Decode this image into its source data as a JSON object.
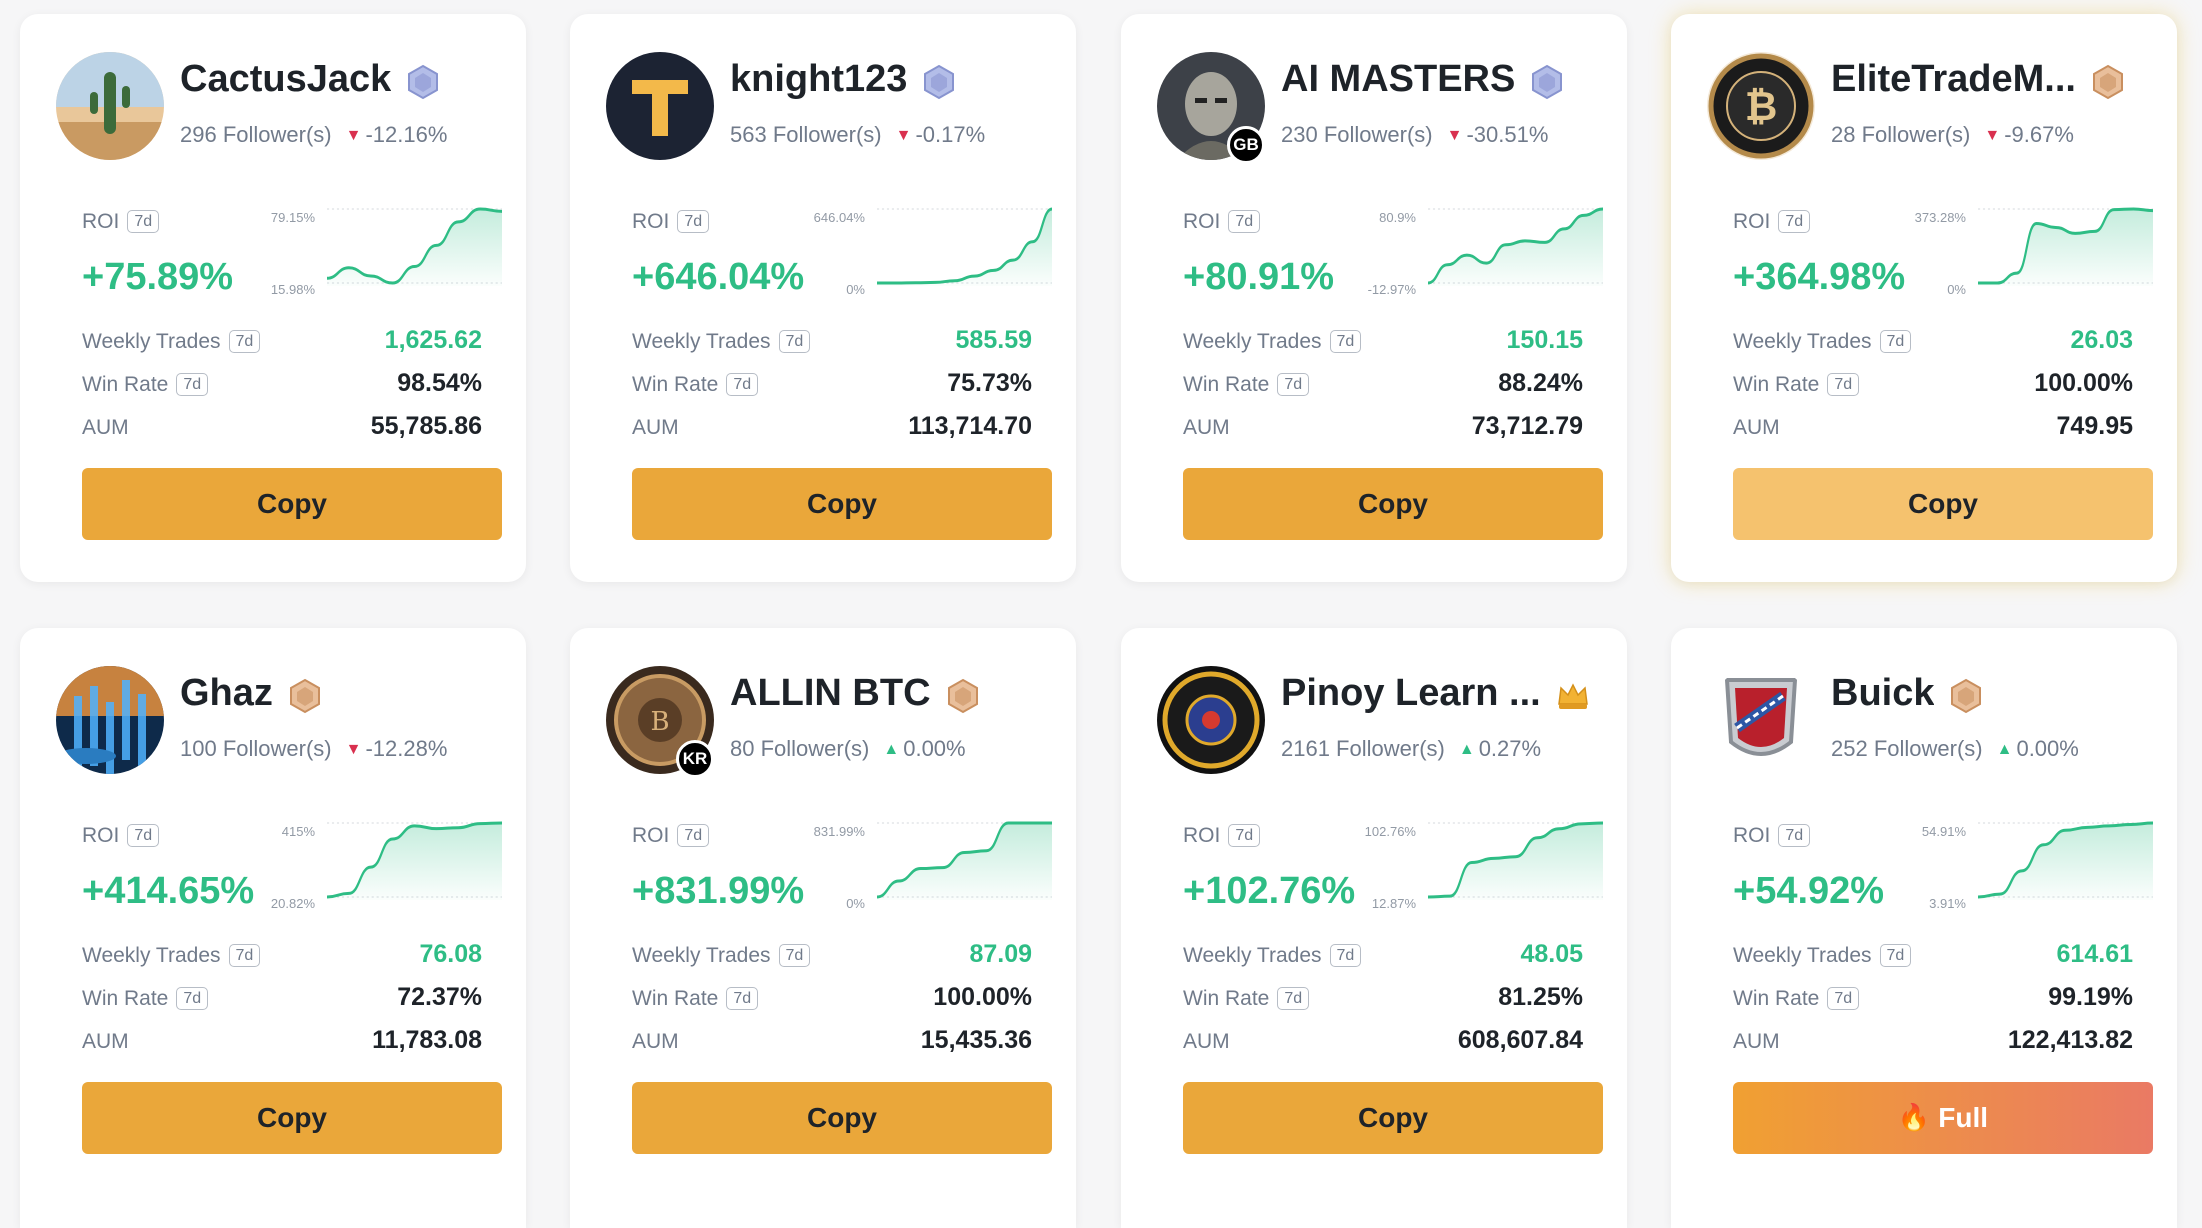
{
  "common": {
    "roi_label": "ROI",
    "weekly_trades_label": "Weekly Trades",
    "win_rate_label": "Win Rate",
    "aum_label": "AUM",
    "period_tag": "7d"
  },
  "colors": {
    "positive": "#2ebd85",
    "negative": "#d9304f",
    "copy_button": "#eaa73a",
    "copy_button_light": "#f5c26e",
    "full_button_gradient": [
      "#f0a032",
      "#ea7a64"
    ]
  },
  "traders": [
    {
      "name": "CactusJack",
      "badge": "diamond-badge-icon",
      "followers": "296 Follower(s)",
      "change": "-12.16%",
      "change_dir": "down",
      "roi": "+75.89%",
      "chart_max": "79.15%",
      "chart_min": "15.98%",
      "sparkline": [
        20,
        29,
        22,
        16,
        30,
        48,
        68,
        79,
        77
      ],
      "weekly_trades": "1,625.62",
      "win_rate": "98.54%",
      "aum": "55,785.86",
      "button": "Copy",
      "button_style": "copy",
      "avatar": "cactus-avatar",
      "country": ""
    },
    {
      "name": "knight123",
      "badge": "diamond-badge-icon",
      "followers": "563 Follower(s)",
      "change": "-0.17%",
      "change_dir": "down",
      "roi": "+646.04%",
      "chart_max": "646.04%",
      "chart_min": "0%",
      "sparkline": [
        0,
        0,
        2,
        5,
        20,
        60,
        110,
        200,
        360,
        646
      ],
      "weekly_trades": "585.59",
      "win_rate": "75.73%",
      "aum": "113,714.70",
      "button": "Copy",
      "button_style": "copy",
      "avatar": "letter-t-avatar",
      "country": ""
    },
    {
      "name": "AI MASTERS",
      "badge": "diamond-badge-icon",
      "followers": "230 Follower(s)",
      "change": "-30.51%",
      "change_dir": "down",
      "roi": "+80.91%",
      "chart_max": "80.9%",
      "chart_min": "-12.97%",
      "sparkline": [
        -13,
        10,
        22,
        12,
        35,
        40,
        38,
        55,
        72,
        80
      ],
      "weekly_trades": "150.15",
      "win_rate": "88.24%",
      "aum": "73,712.79",
      "button": "Copy",
      "button_style": "copy",
      "avatar": "robot-portrait-avatar",
      "country": "GB"
    },
    {
      "name": "EliteTradeM...",
      "badge": "bronze-badge-icon",
      "followers": "28 Follower(s)",
      "change": "-9.67%",
      "change_dir": "down",
      "roi": "+364.98%",
      "chart_max": "373.28%",
      "chart_min": "0%",
      "sparkline": [
        0,
        0,
        50,
        300,
        280,
        250,
        260,
        370,
        373,
        365
      ],
      "weekly_trades": "26.03",
      "win_rate": "100.00%",
      "aum": "749.95",
      "button": "Copy",
      "button_style": "light",
      "avatar": "bitcoin-coin-avatar",
      "country": ""
    },
    {
      "name": "Ghaz",
      "badge": "bronze-badge-icon",
      "followers": "100 Follower(s)",
      "change": "-12.28%",
      "change_dir": "down",
      "roi": "+414.65%",
      "chart_max": "415%",
      "chart_min": "20.82%",
      "sparkline": [
        21,
        40,
        180,
        330,
        400,
        385,
        390,
        412,
        415
      ],
      "weekly_trades": "76.08",
      "win_rate": "72.37%",
      "aum": "11,783.08",
      "button": "Copy",
      "button_style": "copy",
      "avatar": "neon-city-avatar",
      "country": ""
    },
    {
      "name": "ALLIN BTC",
      "badge": "bronze-badge-icon",
      "followers": "80 Follower(s)",
      "change": "0.00%",
      "change_dir": "up",
      "roi": "+831.99%",
      "chart_max": "831.99%",
      "chart_min": "0%",
      "sparkline": [
        0,
        180,
        320,
        330,
        500,
        520,
        832,
        832,
        832
      ],
      "weekly_trades": "87.09",
      "win_rate": "100.00%",
      "aum": "15,435.36",
      "button": "Copy",
      "button_style": "copy",
      "avatar": "bronze-coin-avatar",
      "country": "KR"
    },
    {
      "name": "Pinoy Learn ...",
      "badge": "gold-crown-badge-icon",
      "followers": "2161 Follower(s)",
      "change": "0.27%",
      "change_dir": "up",
      "roi": "+102.76%",
      "chart_max": "102.76%",
      "chart_min": "12.87%",
      "sparkline": [
        13,
        14,
        55,
        60,
        62,
        85,
        96,
        102,
        103
      ],
      "weekly_trades": "48.05",
      "win_rate": "81.25%",
      "aum": "608,607.84",
      "button": "Copy",
      "button_style": "copy",
      "avatar": "pinoy-emblem-avatar",
      "country": ""
    },
    {
      "name": "Buick",
      "badge": "bronze-badge-icon",
      "followers": "252 Follower(s)",
      "change": "0.00%",
      "change_dir": "up",
      "roi": "+54.92%",
      "chart_max": "54.91%",
      "chart_min": "3.91%",
      "sparkline": [
        4,
        6,
        22,
        40,
        50,
        52,
        53,
        54,
        55
      ],
      "weekly_trades": "614.61",
      "win_rate": "99.19%",
      "aum": "122,413.82",
      "button": "Full",
      "button_style": "full",
      "avatar": "buick-shield-avatar",
      "country": ""
    }
  ]
}
